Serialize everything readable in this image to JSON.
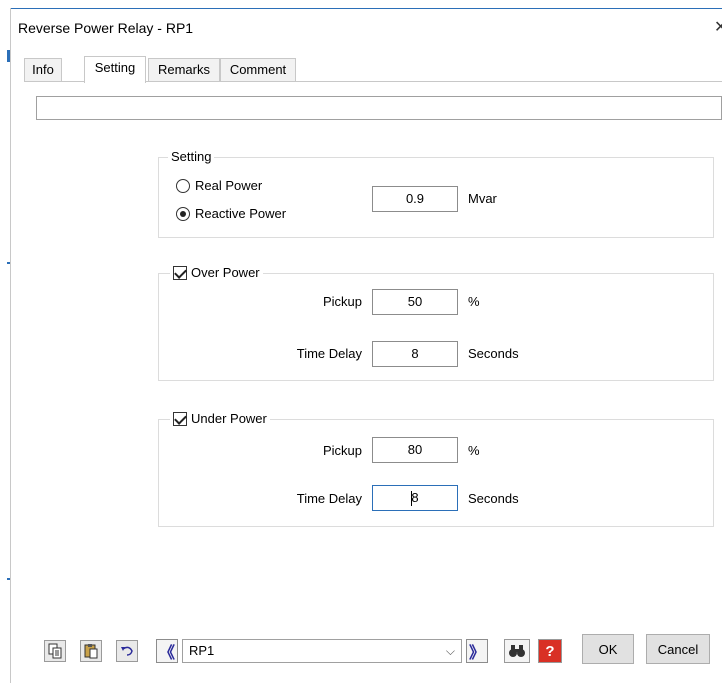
{
  "window": {
    "title": "Reverse Power Relay - RP1",
    "close_glyph": "✕"
  },
  "tabs": [
    {
      "label": "Info",
      "active": false
    },
    {
      "label": "Setting",
      "active": true
    },
    {
      "label": "Remarks",
      "active": false
    },
    {
      "label": "Comment",
      "active": false
    }
  ],
  "top_field": {
    "value": ""
  },
  "setting_group": {
    "title": "Setting",
    "radio_real": {
      "label": "Real Power",
      "selected": false
    },
    "radio_reactive": {
      "label": "Reactive Power",
      "selected": true
    },
    "value": "0.9",
    "unit": "Mvar"
  },
  "over_power": {
    "title": "Over Power",
    "checked": true,
    "pickup_label": "Pickup",
    "pickup_value": "50",
    "pickup_unit": "%",
    "delay_label": "Time Delay",
    "delay_value": "8",
    "delay_unit": "Seconds"
  },
  "under_power": {
    "title": "Under Power",
    "checked": true,
    "pickup_label": "Pickup",
    "pickup_value": "80",
    "pickup_unit": "%",
    "delay_label": "Time Delay",
    "delay_value": "8",
    "delay_unit": "Seconds"
  },
  "bottom": {
    "copy_icon": "copy-icon",
    "paste_icon": "paste-icon",
    "undo_icon": "undo-icon",
    "prev_glyph": "《",
    "next_glyph": "》",
    "element_select": "RP1",
    "find_icon": "binoculars-icon",
    "help_glyph": "?",
    "ok_label": "OK",
    "cancel_label": "Cancel"
  },
  "colors": {
    "accent": "#2b6fb8",
    "nav": "#2a2a9a",
    "help": "#d93025"
  }
}
